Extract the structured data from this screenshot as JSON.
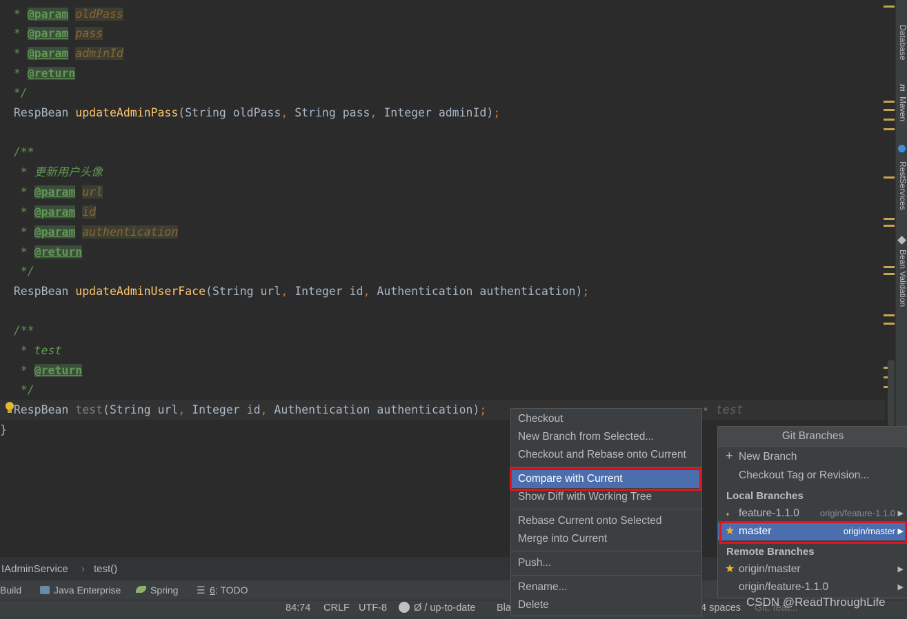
{
  "editor": {
    "lines": [
      {
        "segs": [
          [
            "cmt",
            "  * "
          ],
          [
            "tag",
            "@param"
          ],
          [
            "plain",
            " "
          ],
          [
            "pname",
            "oldPass"
          ]
        ]
      },
      {
        "segs": [
          [
            "cmt",
            "  * "
          ],
          [
            "tag",
            "@param"
          ],
          [
            "plain",
            " "
          ],
          [
            "pname",
            "pass"
          ]
        ]
      },
      {
        "segs": [
          [
            "cmt",
            "  * "
          ],
          [
            "tag",
            "@param"
          ],
          [
            "plain",
            " "
          ],
          [
            "pname",
            "adminId"
          ]
        ]
      },
      {
        "segs": [
          [
            "cmt",
            "  * "
          ],
          [
            "tag",
            "@return"
          ]
        ]
      },
      {
        "segs": [
          [
            "cmt",
            "  */"
          ]
        ]
      },
      {
        "segs": [
          [
            "plain",
            "  RespBean "
          ],
          [
            "meth",
            "updateAdminPass"
          ],
          [
            "plain",
            "(String oldPass"
          ],
          [
            "kw",
            ", "
          ],
          [
            "plain",
            "String pass"
          ],
          [
            "kw",
            ", "
          ],
          [
            "plain",
            "Integer adminId)"
          ],
          [
            "kw",
            ";"
          ]
        ]
      },
      {
        "segs": []
      },
      {
        "segs": [
          [
            "cmt",
            "  /**"
          ]
        ]
      },
      {
        "segs": [
          [
            "cmt",
            "   * 更新用户头像"
          ]
        ]
      },
      {
        "segs": [
          [
            "cmt",
            "   * "
          ],
          [
            "tag",
            "@param"
          ],
          [
            "plain",
            " "
          ],
          [
            "pname",
            "url"
          ]
        ]
      },
      {
        "segs": [
          [
            "cmt",
            "   * "
          ],
          [
            "tag",
            "@param"
          ],
          [
            "plain",
            " "
          ],
          [
            "pname",
            "id"
          ]
        ]
      },
      {
        "segs": [
          [
            "cmt",
            "   * "
          ],
          [
            "tag",
            "@param"
          ],
          [
            "plain",
            " "
          ],
          [
            "pname",
            "authentication"
          ]
        ]
      },
      {
        "segs": [
          [
            "cmt",
            "   * "
          ],
          [
            "tag",
            "@return"
          ]
        ]
      },
      {
        "segs": [
          [
            "cmt",
            "   */"
          ]
        ]
      },
      {
        "segs": [
          [
            "plain",
            "  RespBean "
          ],
          [
            "meth",
            "updateAdminUserFace"
          ],
          [
            "plain",
            "(String url"
          ],
          [
            "kw",
            ", "
          ],
          [
            "plain",
            "Integer id"
          ],
          [
            "kw",
            ", "
          ],
          [
            "plain",
            "Authentication authentication)"
          ],
          [
            "kw",
            ";"
          ]
        ]
      },
      {
        "segs": []
      },
      {
        "segs": [
          [
            "cmt",
            "  /**"
          ]
        ]
      },
      {
        "segs": [
          [
            "cmt",
            "   * test"
          ]
        ]
      },
      {
        "segs": [
          [
            "cmt",
            "   * "
          ],
          [
            "tag",
            "@return"
          ]
        ]
      },
      {
        "segs": [
          [
            "cmt",
            "   */"
          ]
        ]
      },
      {
        "segs": [
          [
            "plain",
            "  RespBean "
          ],
          [
            "grey",
            "test"
          ],
          [
            "plain",
            "(String url"
          ],
          [
            "kw",
            ", "
          ],
          [
            "plain",
            "Integer id"
          ],
          [
            "kw",
            ", "
          ],
          [
            "plain",
            "Authentication authentication)"
          ],
          [
            "kw",
            ";"
          ]
        ]
      },
      {
        "segs": [
          [
            "plain",
            "}"
          ]
        ]
      }
    ],
    "inline_hint": "• test"
  },
  "right_tool_tabs": [
    "Database",
    "Maven",
    "RestServices",
    "Bean Validation"
  ],
  "breadcrumb": {
    "items": [
      "IAdminService",
      "test()"
    ]
  },
  "toolbar": {
    "build": "Build",
    "java_enterprise": "Java Enterprise",
    "spring": "Spring",
    "todo_num": "6",
    "todo": ": TODO"
  },
  "status": {
    "position": "84:74",
    "line_sep": "CRLF",
    "encoding": "UTF-8",
    "vcs": "Ø / up-to-date",
    "bla": "Bla",
    "indent": "4 spaces",
    "git": "Git: feat..."
  },
  "context_menu": {
    "items": [
      "Checkout",
      "New Branch from Selected...",
      "Checkout and Rebase onto Current",
      "Compare with Current",
      "Show Diff with Working Tree",
      "Rebase Current onto Selected",
      "Merge into Current",
      "Push...",
      "Rename...",
      "Delete"
    ],
    "selected": "Compare with Current"
  },
  "git_branches": {
    "title": "Git Branches",
    "new_branch": "New Branch",
    "checkout_tag": "Checkout Tag or Revision...",
    "local_title": "Local Branches",
    "local": [
      {
        "name": "feature-1.1.0",
        "remote": "origin/feature-1.1.0"
      },
      {
        "name": "master",
        "remote": "origin/master"
      }
    ],
    "remote_title": "Remote Branches",
    "remote": [
      "origin/master",
      "origin/feature-1.1.0"
    ]
  },
  "watermark": "CSDN @ReadThroughLife"
}
